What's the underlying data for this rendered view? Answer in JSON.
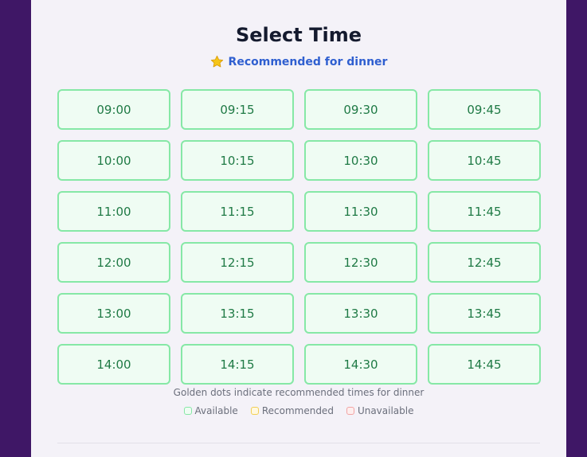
{
  "header": {
    "title": "Select Time",
    "recommendation_icon": "star-icon",
    "recommendation_text": "Recommended for dinner"
  },
  "time_slots": [
    {
      "time": "09:00",
      "status": "available"
    },
    {
      "time": "09:15",
      "status": "available"
    },
    {
      "time": "09:30",
      "status": "available"
    },
    {
      "time": "09:45",
      "status": "available"
    },
    {
      "time": "10:00",
      "status": "available"
    },
    {
      "time": "10:15",
      "status": "available"
    },
    {
      "time": "10:30",
      "status": "available"
    },
    {
      "time": "10:45",
      "status": "available"
    },
    {
      "time": "11:00",
      "status": "available"
    },
    {
      "time": "11:15",
      "status": "available"
    },
    {
      "time": "11:30",
      "status": "available"
    },
    {
      "time": "11:45",
      "status": "available"
    },
    {
      "time": "12:00",
      "status": "available"
    },
    {
      "time": "12:15",
      "status": "available"
    },
    {
      "time": "12:30",
      "status": "available"
    },
    {
      "time": "12:45",
      "status": "available"
    },
    {
      "time": "13:00",
      "status": "available"
    },
    {
      "time": "13:15",
      "status": "available"
    },
    {
      "time": "13:30",
      "status": "available"
    },
    {
      "time": "13:45",
      "status": "available"
    },
    {
      "time": "14:00",
      "status": "available"
    },
    {
      "time": "14:15",
      "status": "available"
    },
    {
      "time": "14:30",
      "status": "available"
    },
    {
      "time": "14:45",
      "status": "available"
    }
  ],
  "hint": "Golden dots indicate recommended times for dinner",
  "legend": {
    "available": "Available",
    "recommended": "Recommended",
    "unavailable": "Unavailable"
  },
  "colors": {
    "background": "#3f1766",
    "card": "#f4f2f8",
    "title": "#141a2e",
    "accent": "#2f5fd0",
    "available_border": "#86e8a6",
    "available_fill": "#effcf3",
    "available_text": "#1f7a45",
    "recommended_border": "#f2cf54",
    "unavailable_border": "#f2a3a3"
  }
}
